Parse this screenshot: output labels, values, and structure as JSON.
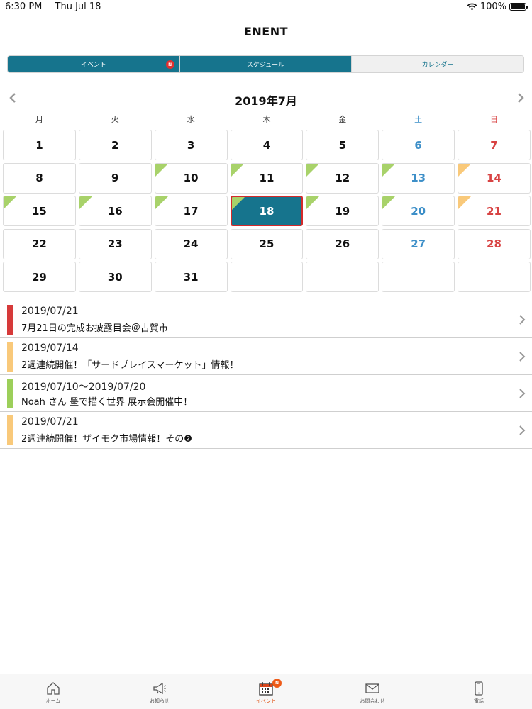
{
  "status_bar": {
    "time": "6:30 PM",
    "date": "Thu Jul 18",
    "battery": "100%",
    "battery_level": 1.0
  },
  "header": {
    "title": "ENENT"
  },
  "segments": [
    {
      "label": "イベント",
      "badge": "N",
      "active": true
    },
    {
      "label": "スケジュール",
      "active": true
    },
    {
      "label": "カレンダー",
      "active": false
    }
  ],
  "calendar": {
    "month_title": "2019年7月",
    "weekdays": [
      "月",
      "火",
      "水",
      "木",
      "金",
      "土",
      "日"
    ],
    "weeks": [
      [
        {
          "d": "1"
        },
        {
          "d": "2"
        },
        {
          "d": "3"
        },
        {
          "d": "4"
        },
        {
          "d": "5"
        },
        {
          "d": "6"
        },
        {
          "d": "7"
        }
      ],
      [
        {
          "d": "8"
        },
        {
          "d": "9"
        },
        {
          "d": "10",
          "mark": "green"
        },
        {
          "d": "11",
          "mark": "green"
        },
        {
          "d": "12",
          "mark": "green"
        },
        {
          "d": "13",
          "mark": "green"
        },
        {
          "d": "14",
          "mark": "orange"
        }
      ],
      [
        {
          "d": "15",
          "mark": "green"
        },
        {
          "d": "16",
          "mark": "green"
        },
        {
          "d": "17",
          "mark": "green"
        },
        {
          "d": "18",
          "mark": "green",
          "today": true
        },
        {
          "d": "19",
          "mark": "green"
        },
        {
          "d": "20",
          "mark": "green"
        },
        {
          "d": "21",
          "mark": "orange"
        }
      ],
      [
        {
          "d": "22"
        },
        {
          "d": "23"
        },
        {
          "d": "24"
        },
        {
          "d": "25"
        },
        {
          "d": "26"
        },
        {
          "d": "27"
        },
        {
          "d": "28"
        }
      ],
      [
        {
          "d": "29"
        },
        {
          "d": "30"
        },
        {
          "d": "31"
        },
        {
          "d": ""
        },
        {
          "d": ""
        },
        {
          "d": ""
        },
        {
          "d": ""
        }
      ]
    ],
    "mark_colors": {
      "green": "#a8d26a",
      "orange": "#f9c97a"
    }
  },
  "events": [
    {
      "date": "2019/07/21",
      "title": "7月21日の完成お披露目会＠古賀市",
      "color": "#d63a3a"
    },
    {
      "date": "2019/07/14",
      "title": "2週連続開催！「サードプレイスマーケット」情報！",
      "color": "#f9c97a"
    },
    {
      "date": "2019/07/10〜2019/07/20",
      "title": "Noah さん 墨で描く世界 展示会開催中！",
      "color": "#9ccf5a"
    },
    {
      "date": "2019/07/21",
      "title": "2週連続開催！ザイモク市場情報！その❷",
      "color": "#f9c97a"
    }
  ],
  "tabbar": [
    {
      "label": "ホーム",
      "icon": "home-icon"
    },
    {
      "label": "お知らせ",
      "icon": "megaphone-icon"
    },
    {
      "label": "イベント",
      "icon": "calendar-icon",
      "active": true,
      "badge": "N"
    },
    {
      "label": "お問合わせ",
      "icon": "mail-icon"
    },
    {
      "label": "電話",
      "icon": "phone-icon"
    }
  ],
  "colors": {
    "accent": "#16748d",
    "today_border": "#d42a2a",
    "saturday": "#3d8fc8",
    "sunday": "#d84343",
    "active_tab": "#e0571a"
  }
}
